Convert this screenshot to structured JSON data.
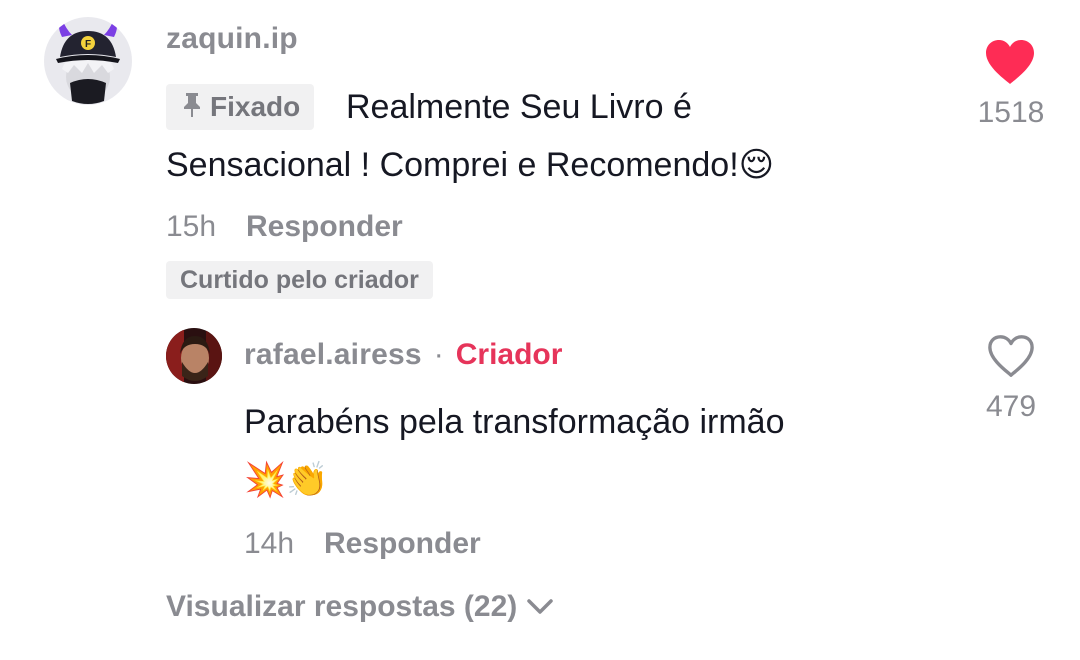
{
  "comment": {
    "username": "zaquin.ip",
    "pinned_label": "Fixado",
    "text_line1": "Realmente Seu Livro é",
    "text_line2": "Sensacional ! Comprei e Recomendo!",
    "emoji": "😌",
    "time": "15h",
    "reply_label": "Responder",
    "liked_by_creator": "Curtido pelo criador",
    "like_count": "1518",
    "liked": true,
    "like_color": "#fe2c55"
  },
  "reply": {
    "username": "rafael.airess",
    "separator": "·",
    "creator_badge": "Criador",
    "creator_color": "#e6345a",
    "text": "Parabéns pela transformação irmão",
    "emojis": "💥👏",
    "time": "14h",
    "reply_label": "Responder",
    "like_count": "479",
    "liked": false
  },
  "view_replies": {
    "label": "Visualizar respostas (22)",
    "icon": "chevron-down-icon"
  }
}
